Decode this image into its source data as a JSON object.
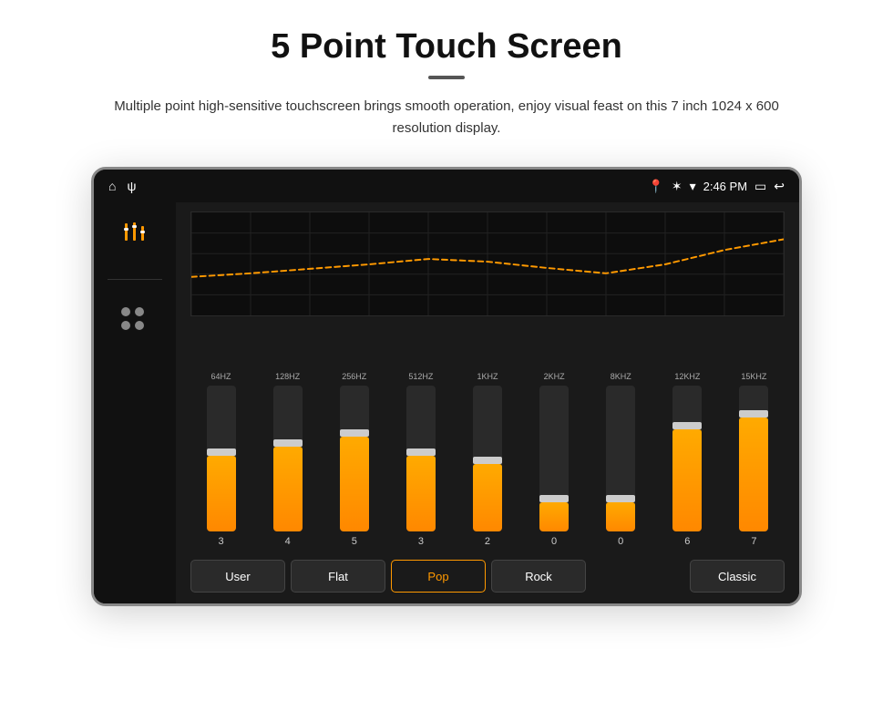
{
  "page": {
    "title": "5 Point Touch Screen",
    "subtitle": "Multiple point high-sensitive touchscreen brings smooth operation, enjoy visual feast on this 7 inch 1024 x 600 resolution display."
  },
  "statusBar": {
    "leftIcons": [
      "⌂",
      "ψ"
    ],
    "rightIcons": [
      "📍",
      "✶",
      "▾"
    ],
    "time": "2:46 PM",
    "batteryIcon": "🔋",
    "backIcon": "↩"
  },
  "sidebar": {
    "equalizerIcon": "⊞",
    "appsIcon": "⠿"
  },
  "eqBands": [
    {
      "freq": "64HZ",
      "value": 3,
      "fillPct": 52
    },
    {
      "freq": "128HZ",
      "value": 4,
      "fillPct": 58
    },
    {
      "freq": "256HZ",
      "value": 5,
      "fillPct": 65
    },
    {
      "freq": "512HZ",
      "value": 3,
      "fillPct": 52
    },
    {
      "freq": "1KHZ",
      "value": 2,
      "fillPct": 46
    },
    {
      "freq": "2KHZ",
      "value": 0,
      "fillPct": 20
    },
    {
      "freq": "8KHZ",
      "value": 0,
      "fillPct": 20
    },
    {
      "freq": "12KHZ",
      "value": 6,
      "fillPct": 70
    },
    {
      "freq": "15KHZ",
      "value": 7,
      "fillPct": 78
    }
  ],
  "presets": [
    {
      "label": "User",
      "active": false
    },
    {
      "label": "Flat",
      "active": false
    },
    {
      "label": "Pop",
      "active": true
    },
    {
      "label": "Rock",
      "active": false
    },
    {
      "label": "Classic",
      "active": false
    }
  ],
  "colors": {
    "orange": "#ff8800",
    "dark": "#1a1a1a",
    "darker": "#111"
  }
}
